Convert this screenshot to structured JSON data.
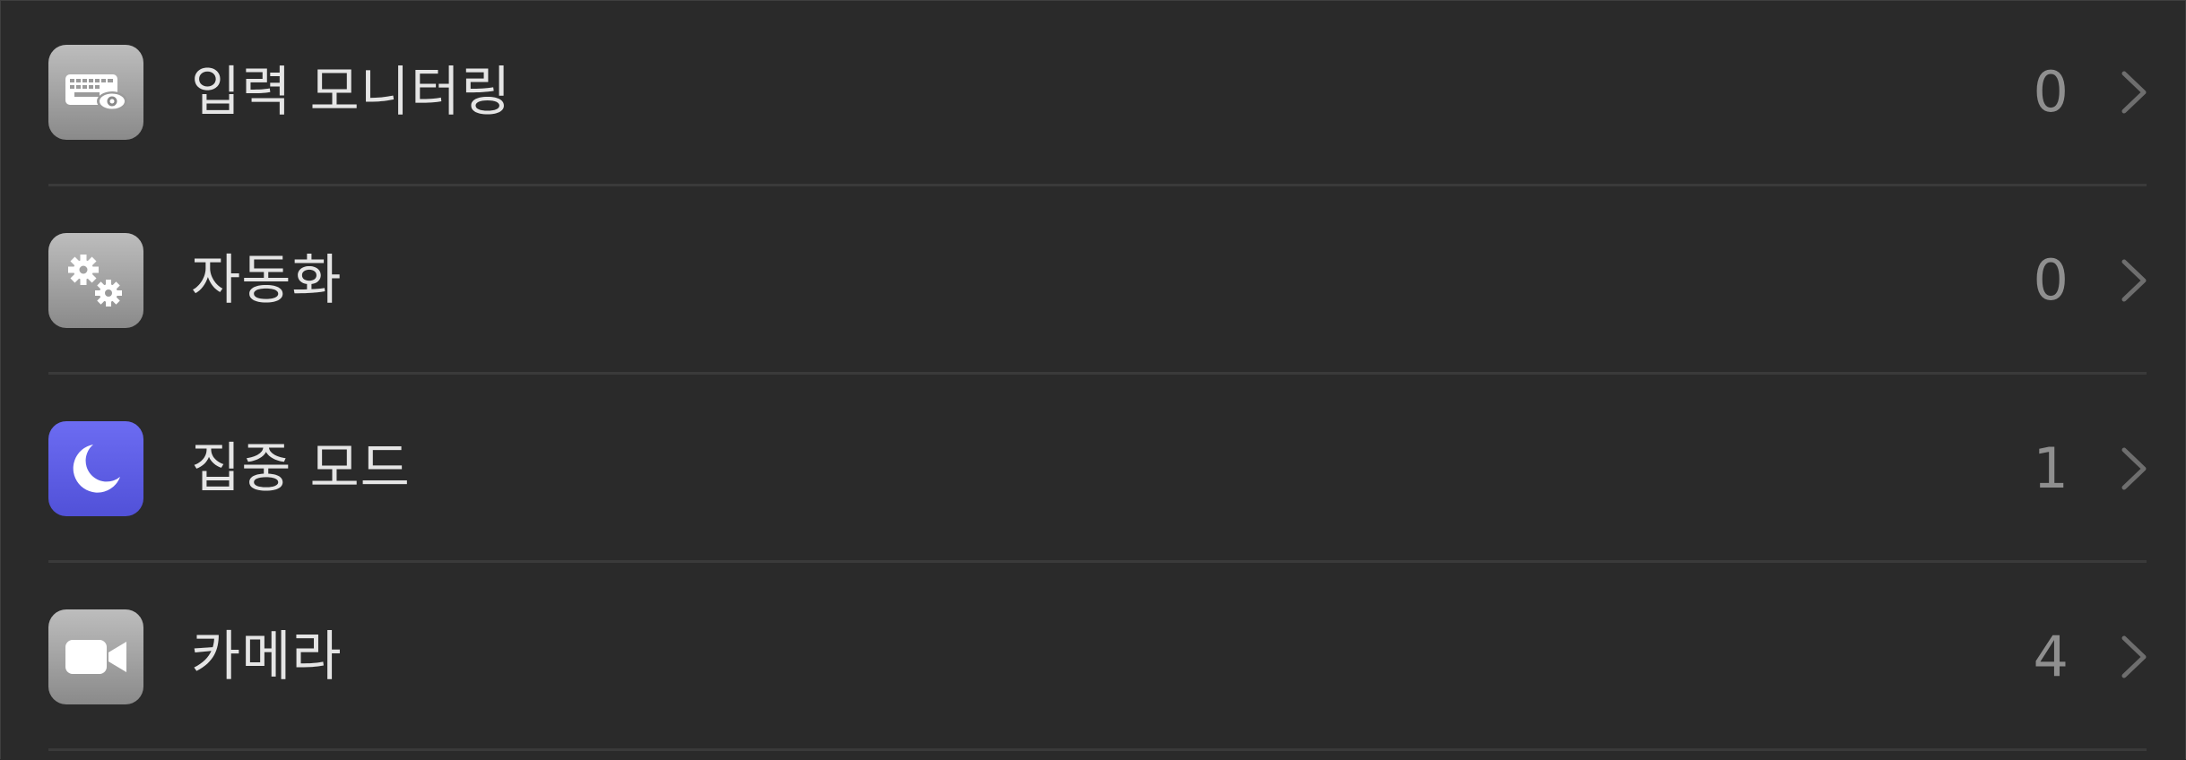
{
  "settings_list": {
    "rows": [
      {
        "label": "입력 모니터링",
        "count": "0",
        "icon": "keyboard-eye-icon",
        "tile_color": "#a3a3a3"
      },
      {
        "label": "자동화",
        "count": "0",
        "icon": "gears-icon",
        "tile_color": "#a3a3a3"
      },
      {
        "label": "집중 모드",
        "count": "1",
        "icon": "moon-icon",
        "tile_color": "#5e5ee6"
      },
      {
        "label": "카메라",
        "count": "4",
        "icon": "video-camera-icon",
        "tile_color": "#a3a3a3"
      }
    ]
  },
  "colors": {
    "background": "#2a2a2a",
    "label_text": "#e5e5e5",
    "count_text": "#8f8f8f",
    "divider": "#3a3a3a"
  }
}
